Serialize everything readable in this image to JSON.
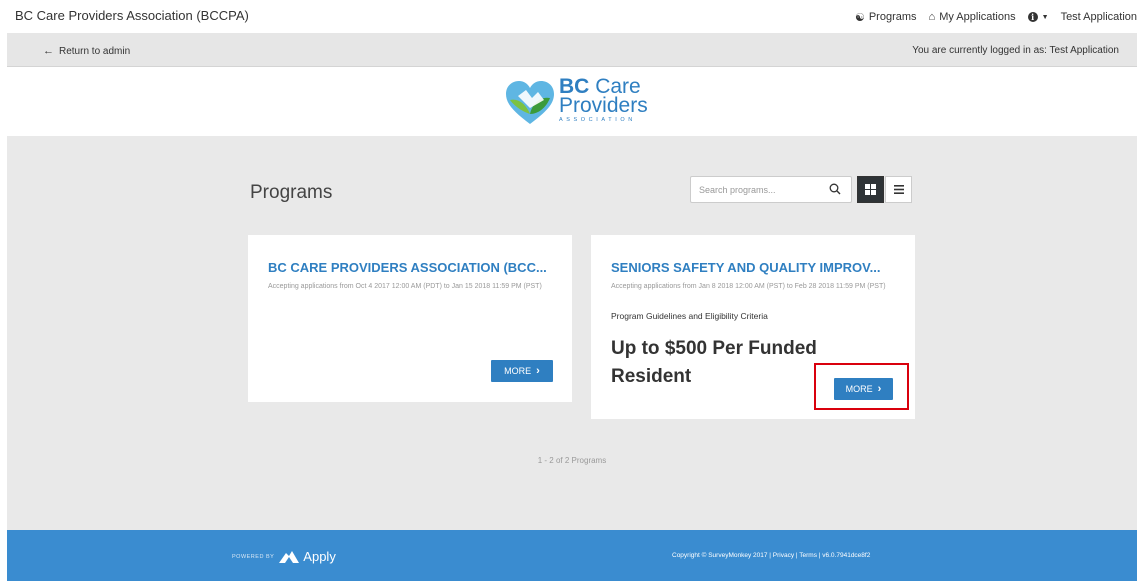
{
  "topnav": {
    "brand": "BC Care Providers Association (BCCPA)",
    "programs": "Programs",
    "my_applications": "My Applications",
    "user": "Test Application"
  },
  "adminbar": {
    "return_label": "Return to admin",
    "logged_in": "You are currently logged in as: Test Application"
  },
  "logo": {
    "line1_bold": "BC",
    "line1_rest": "Care",
    "line2": "Providers",
    "line3": "ASSOCIATION"
  },
  "main": {
    "title": "Programs",
    "search_placeholder": "Search programs...",
    "count": "1 - 2 of 2 Programs"
  },
  "cards": [
    {
      "title": "BC CARE PROVIDERS ASSOCIATION (BCC...",
      "subtitle": "Accepting applications from Oct 4 2017 12:00 AM (PDT) to Jan 15 2018 11:59 PM (PST)",
      "more_label": "MORE"
    },
    {
      "title": "SENIORS SAFETY AND QUALITY IMPROV...",
      "subtitle": "Accepting applications from Jan 8 2018 12:00 AM (PST) to Feb 28 2018 11:59 PM (PST)",
      "guidelines": "Program Guidelines and Eligibility Criteria",
      "headline": "Up to $500 Per Funded Resident",
      "more_label": "MORE"
    }
  ],
  "footer": {
    "powered_by": "POWERED BY",
    "apply": "Apply",
    "copyright": "Copyright © SurveyMonkey 2017 | Privacy | Terms | v6.0.7941dce8f2"
  },
  "colors": {
    "accent": "#2f7fc1",
    "footer": "#3a8cd0",
    "highlight": "#d9000d"
  }
}
